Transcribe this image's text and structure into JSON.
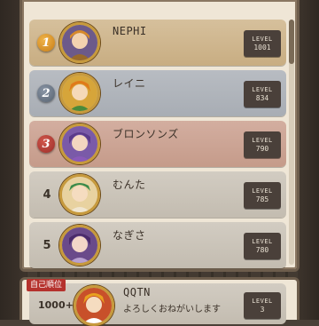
{
  "ranking": [
    {
      "rank": "1",
      "name": "NEPHI",
      "level_label": "LEVEL",
      "level": "1001",
      "tier": "gold",
      "avatar_icon": "character-portrait-icon"
    },
    {
      "rank": "2",
      "name": "レイニ",
      "level_label": "LEVEL",
      "level": "834",
      "tier": "silver",
      "avatar_icon": "character-portrait-icon"
    },
    {
      "rank": "3",
      "name": "ブロンソンズ",
      "level_label": "LEVEL",
      "level": "790",
      "tier": "bronze",
      "avatar_icon": "character-portrait-icon"
    },
    {
      "rank": "4",
      "name": "むんた",
      "level_label": "LEVEL",
      "level": "785",
      "tier": "plain",
      "avatar_icon": "character-portrait-icon"
    },
    {
      "rank": "5",
      "name": "なぎさ",
      "level_label": "LEVEL",
      "level": "780",
      "tier": "plain",
      "avatar_icon": "character-portrait-icon"
    }
  ],
  "self": {
    "label": "自己順位",
    "rank": "1000+",
    "name": "QQTN",
    "message": "よろしくおねがいします",
    "level_label": "LEVEL",
    "level": "3"
  },
  "colors": {
    "gold": "#c8ad82",
    "silver": "#a8adb4",
    "bronze": "#c59b8a",
    "plain": "#c3bcb0",
    "accent_red": "#b5322d"
  }
}
